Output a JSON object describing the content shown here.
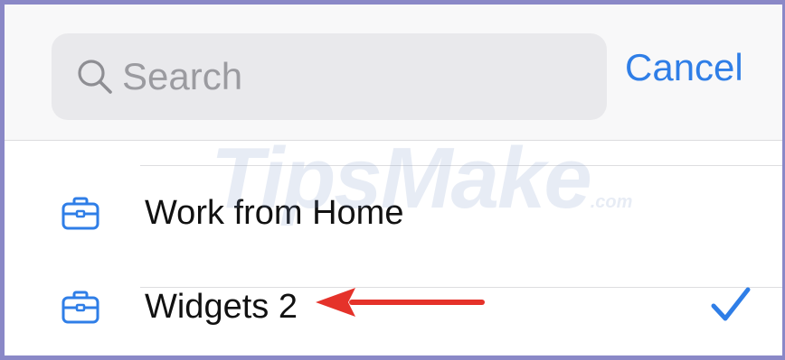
{
  "search": {
    "placeholder": "Search"
  },
  "cancel_label": "Cancel",
  "rows": [
    {
      "label": "Work from Home",
      "icon": "briefcase-icon",
      "selected": false
    },
    {
      "label": "Widgets 2",
      "icon": "briefcase-icon",
      "selected": true
    }
  ],
  "watermark": {
    "text": "TipsMake",
    "suffix": ".com"
  },
  "colors": {
    "accent": "#2f7ee7",
    "annotation_arrow": "#e5322a",
    "search_background": "#e9e9ec",
    "header_background": "#f8f8f9",
    "frame_border": "#8a88c7"
  }
}
